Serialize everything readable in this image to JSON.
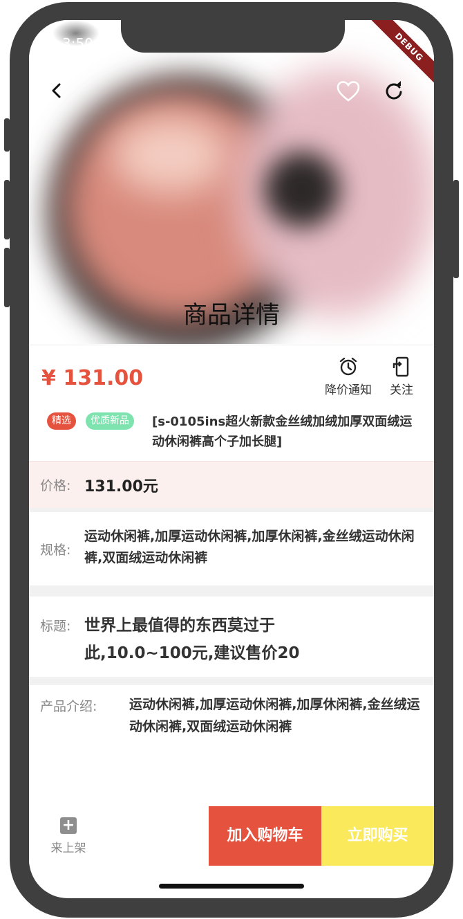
{
  "status": {
    "time": "3:50",
    "debug_banner": "DEBUG"
  },
  "header": {
    "title": "商品详情"
  },
  "icons": {
    "back": "chevron-left-icon",
    "favorite": "heart-outline-icon",
    "refresh": "refresh-icon"
  },
  "product": {
    "price": "¥ 131.00",
    "actions": [
      {
        "label": "降价通知",
        "icon": "alarm-clock-icon"
      },
      {
        "label": "关注",
        "icon": "phone-share-icon"
      }
    ],
    "tags": [
      {
        "label": "精选",
        "color": "#e5533f"
      },
      {
        "label": "优质新品",
        "color": "#7fe3b0"
      }
    ],
    "name": "[s-0105ins超火新款金丝绒加绒加厚双面绒运动休闲裤高个子加长腿]"
  },
  "details": {
    "price_label": "价格:",
    "price_value": "131.00元",
    "spec_label": "规格:",
    "spec_value": "运动休闲裤,加厚运动休闲裤,加厚休闲裤,金丝绒运动休闲裤,双面绒运动休闲裤",
    "title_label": "标题:",
    "title_value": "世界上最值得的东西莫过于此,10.0~100元,建议售价20",
    "intro_label": "产品介绍:",
    "intro_value": "运动休闲裤,加厚运动休闲裤,加厚休闲裤,金丝绒运动休闲裤,双面绒运动休闲裤"
  },
  "bottom_bar": {
    "shelf_label": "来上架",
    "cart_button": "加入购物车",
    "buy_button": "立即购买"
  },
  "colors": {
    "accent_red": "#e5533f",
    "buy_yellow": "#fbe95c",
    "price_band": "#fcf0ef"
  }
}
